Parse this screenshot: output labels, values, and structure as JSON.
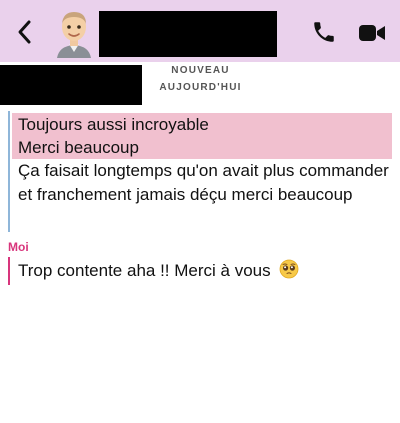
{
  "header": {
    "back_icon": "chevron-left-icon",
    "avatar_icon": "bitmoji-avatar",
    "call_icon": "phone-icon",
    "video_icon": "video-camera-icon",
    "accent_color": "#ead1ec"
  },
  "separator": {
    "line1": "NOUVEAU",
    "line2": "AUJOURD'HUI"
  },
  "conversation": {
    "them": {
      "highlight_line1": "Toujours aussi incroyable",
      "highlight_line2": "Merci beaucoup",
      "message": "Ça faisait longtemps qu'on avait plus commander et franchement jamais déçu merci beaucoup",
      "highlight_color": "#f1c0cf",
      "bar_color": "#8fb6d9"
    },
    "me": {
      "label": "Moi",
      "message": "Trop contente aha !! Merci à vous",
      "emoji": "pleading-face-emoji",
      "color": "#d8357c"
    }
  }
}
